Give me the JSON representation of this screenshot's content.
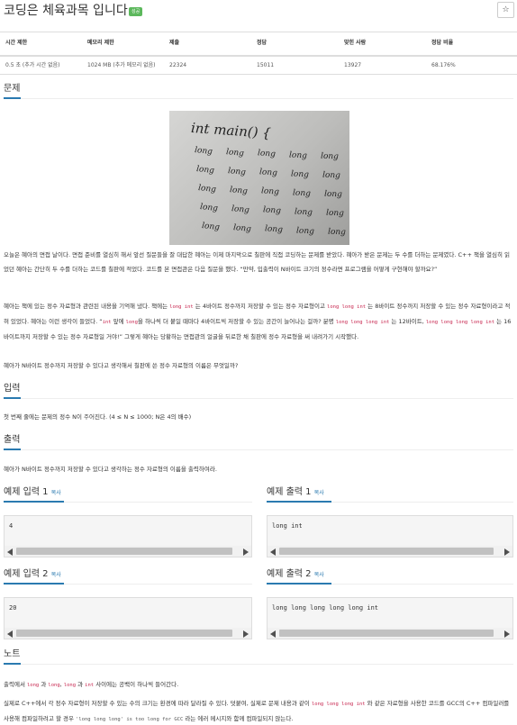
{
  "problem": {
    "title": "코딩은 체육과목 입니다",
    "badge": "성공",
    "star_icon": "star-icon"
  },
  "info_table": {
    "headers": [
      "시간 제한",
      "메모리 제한",
      "제출",
      "정답",
      "맞힌 사람",
      "정답 비율"
    ],
    "values": [
      "0.5 초 (추가 시간 없음)",
      "1024 MB (추가 메모리 없음)",
      "22324",
      "15011",
      "13927",
      "68.176%"
    ]
  },
  "sections": {
    "problem": "문제",
    "input": "입력",
    "output": "출력",
    "note": "노트"
  },
  "figure": {
    "line1": "int main() {",
    "repeat_word": "long"
  },
  "problem_text": {
    "p1": "오늘은 혜아의 면접 날이다. 면접 준비를 열심히 해서 앞선 질문들을 잘 대답한 혜아는 이제 마지막으로 칠판에 직접 코딩하는 문제를 받았다. 혜아가 받은 문제는 두 수를 더하는 문제였다. C++ 책을 열심히 읽었던 혜아는 간단히 두 수를 더하는 코드를 칠판에 적었다. 코드를 본 면접관은 다음 질문을 했다. “만약, 입출력이 N바이트 크기의 정수라면 프로그램을 어떻게 구현해야 할까요?”",
    "p2_a": "혜아는 책에 있는 정수 자료형과 관련된 내용을 기억해 냈다. 책에는",
    "p2_code1": "long int",
    "p2_b": "는 4바이트 정수까지 저장할 수 있는 정수 자료형이고",
    "p2_code2": "long long int",
    "p2_c": "는 8바이트 정수까지 저장할 수 있는 정수 자료형이라고 적혀 있었다. 혜아는 이런 생각이 들었다. “",
    "p2_code3": "int",
    "p2_d": "앞에",
    "p2_code4": "long",
    "p2_e": "을 하나씩 더 붙일 때마다 4바이트씩 저장할 수 있는 공간이 늘어나는 걸까? 분명",
    "p2_code5": "long long long int",
    "p2_f": "는 12바이트,",
    "p2_code6": "long long long long int",
    "p2_g": "는 16바이트까지 저장할 수 있는 정수 자료형일 거야!” 그렇게 혜아는 당황하는 면접관의 얼굴을 뒤로한 채 칠판에 정수 자료형을 써 내려가기 시작했다.",
    "p3": "혜아가 N바이트 정수까지 저장할 수 있다고 생각해서 칠판에 쓴 정수 자료형의 이름은 무엇일까?"
  },
  "input_text": "첫 번째 줄에는 문제의 정수 N이 주어진다. (4 ≤ N ≤ 1000; N은 4의 배수)",
  "output_text": "혜아가 N바이트 정수까지 저장할 수 있다고 생각하는 정수 자료형의 이름을 출력하여라.",
  "samples": [
    {
      "label": "예제 입력 1",
      "copy": "복사",
      "value": "4"
    },
    {
      "label": "예제 출력 1",
      "copy": "복사",
      "value": "long int"
    },
    {
      "label": "예제 입력 2",
      "copy": "복사",
      "value": "20"
    },
    {
      "label": "예제 출력 2",
      "copy": "복사",
      "value": "long long long long long int"
    }
  ],
  "note_text": {
    "n1_a": "출력에서",
    "n1_c1": "long",
    "n1_b": "과",
    "n1_c2": "long",
    "n1_c3": "long",
    "n1_c": "과",
    "n1_c4": "int",
    "n1_d": "사이에는 공백이 하나씩 들어간다.",
    "n2_a": "실제로 C++에서 각 정수 자료형이 저장할 수 있는 수의 크기는 환경에 따라 달라질 수 있다. 덧붙여, 실제로 문제 내용과 같이",
    "n2_c1": "long long long int",
    "n2_b": "와 같은 자료형을 사용한 코드를 GCC의 C++ 컴파일러를 사용해 컴파일하려고 할 경우",
    "n2_c2": "'long long long' is too long for GCC",
    "n2_c": "라는 에러 메시지와 함께 컴파일되지 않는다."
  }
}
